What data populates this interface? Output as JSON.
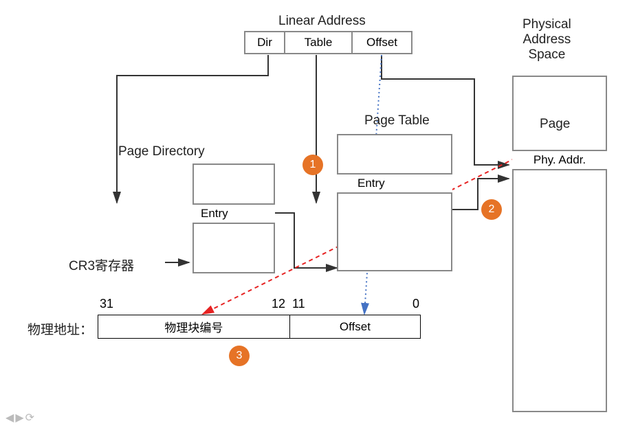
{
  "title_linear_address": "Linear Address",
  "linear_addr_fields": {
    "dir": "Dir",
    "table": "Table",
    "offset": "Offset"
  },
  "page_directory": {
    "title": "Page Directory",
    "entry": "Entry"
  },
  "page_table": {
    "title": "Page Table",
    "entry": "Entry"
  },
  "physical_space": {
    "title": "Physical\nAddress\nSpace",
    "page": "Page",
    "phy_addr": "Phy. Addr."
  },
  "cr3": {
    "label": "CR3寄存器"
  },
  "physical_addr": {
    "label": "物理地址：",
    "block_num": "物理块编号",
    "offset": "Offset"
  },
  "bits": {
    "b31": "31",
    "b12": "12",
    "b11": "11",
    "b0": "0"
  },
  "badges": {
    "one": "1",
    "two": "2",
    "three": "3"
  }
}
